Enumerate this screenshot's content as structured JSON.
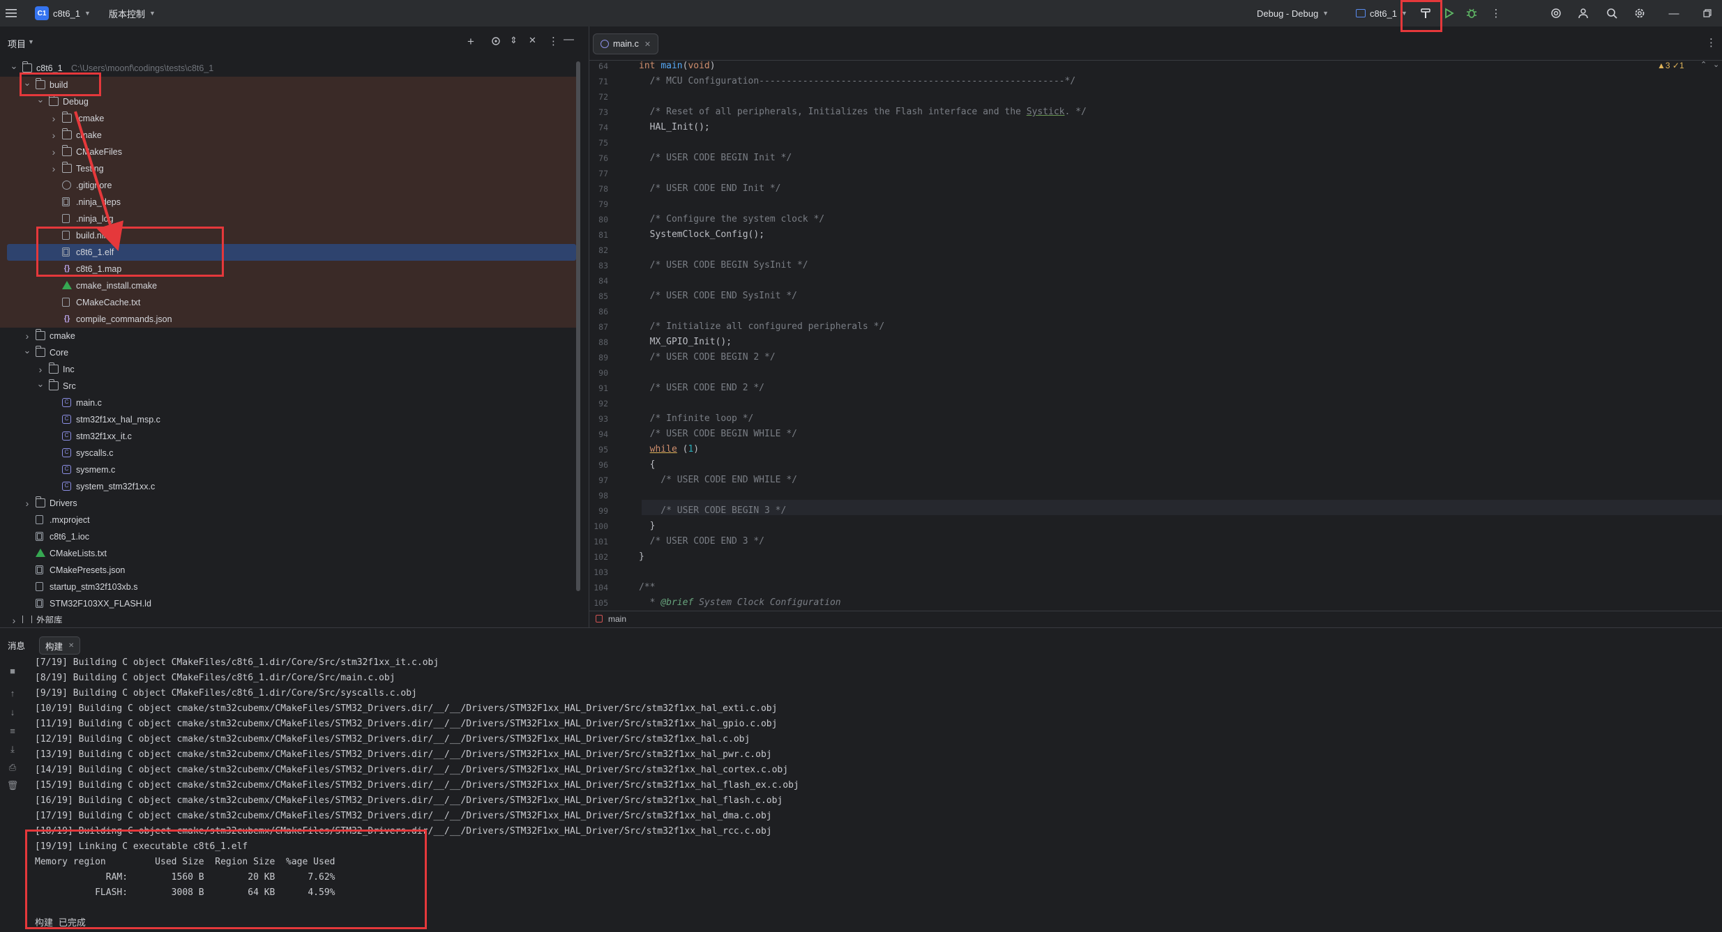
{
  "titlebar": {
    "project_badge": "C1",
    "project_name": "c8t6_1",
    "vcs_label": "版本控制",
    "run_config": "Debug - Debug",
    "target": "c8t6_1"
  },
  "project_panel": {
    "title": "项目",
    "tree": [
      {
        "label": "c8t6_1",
        "extra": "C:\\Users\\moonf\\codings\\tests\\c8t6_1",
        "depth": 0,
        "type": "folder",
        "arrow": "down"
      },
      {
        "label": "build",
        "depth": 1,
        "type": "folder",
        "arrow": "down",
        "hl": true
      },
      {
        "label": "Debug",
        "depth": 2,
        "type": "folder",
        "arrow": "down",
        "hl": true
      },
      {
        "label": ".cmake",
        "depth": 3,
        "type": "folder",
        "arrow": "right",
        "hl": true
      },
      {
        "label": "cmake",
        "depth": 3,
        "type": "folder",
        "arrow": "right",
        "hl": true
      },
      {
        "label": "CMakeFiles",
        "depth": 3,
        "type": "folder",
        "arrow": "right",
        "hl": true
      },
      {
        "label": "Testing",
        "depth": 3,
        "type": "folder",
        "arrow": "right",
        "hl": true
      },
      {
        "label": ".gitignore",
        "depth": 3,
        "type": "ignore",
        "hl": true
      },
      {
        "label": ".ninja_deps",
        "depth": 3,
        "type": "bin",
        "hl": true
      },
      {
        "label": ".ninja_log",
        "depth": 3,
        "type": "text",
        "hl": true
      },
      {
        "label": "build.ninja",
        "depth": 3,
        "type": "text",
        "hl": true
      },
      {
        "label": "c8t6_1.elf",
        "depth": 3,
        "type": "bin",
        "hl": true,
        "selected": true
      },
      {
        "label": "c8t6_1.map",
        "depth": 3,
        "type": "json",
        "hl": true
      },
      {
        "label": "cmake_install.cmake",
        "depth": 3,
        "type": "cmake",
        "hl": true
      },
      {
        "label": "CMakeCache.txt",
        "depth": 3,
        "type": "text",
        "hl": true
      },
      {
        "label": "compile_commands.json",
        "depth": 3,
        "type": "json",
        "hl": true
      },
      {
        "label": "cmake",
        "depth": 1,
        "type": "folder",
        "arrow": "right"
      },
      {
        "label": "Core",
        "depth": 1,
        "type": "folder",
        "arrow": "down"
      },
      {
        "label": "Inc",
        "depth": 2,
        "type": "folder",
        "arrow": "right"
      },
      {
        "label": "Src",
        "depth": 2,
        "type": "folder",
        "arrow": "down"
      },
      {
        "label": "main.c",
        "depth": 3,
        "type": "c"
      },
      {
        "label": "stm32f1xx_hal_msp.c",
        "depth": 3,
        "type": "c"
      },
      {
        "label": "stm32f1xx_it.c",
        "depth": 3,
        "type": "c"
      },
      {
        "label": "syscalls.c",
        "depth": 3,
        "type": "c"
      },
      {
        "label": "sysmem.c",
        "depth": 3,
        "type": "c"
      },
      {
        "label": "system_stm32f1xx.c",
        "depth": 3,
        "type": "c"
      },
      {
        "label": "Drivers",
        "depth": 1,
        "type": "folder",
        "arrow": "right"
      },
      {
        "label": ".mxproject",
        "depth": 1,
        "type": "text"
      },
      {
        "label": "c8t6_1.ioc",
        "depth": 1,
        "type": "bin"
      },
      {
        "label": "CMakeLists.txt",
        "depth": 1,
        "type": "cmake"
      },
      {
        "label": "CMakePresets.json",
        "depth": 1,
        "type": "bin"
      },
      {
        "label": "startup_stm32f103xb.s",
        "depth": 1,
        "type": "text"
      },
      {
        "label": "STM32F103XX_FLASH.ld",
        "depth": 1,
        "type": "bin"
      },
      {
        "label": "外部库",
        "depth": 0,
        "type": "lib",
        "arrow": "right"
      }
    ]
  },
  "editor": {
    "tab_label": "main.c",
    "inspections": "▲3 ✓1",
    "lines": [
      {
        "n": "64",
        "t": "int main(void)",
        "k": "sig"
      },
      {
        "n": "71",
        "t": "  /* MCU Configuration--------------------------------------------------------*/",
        "k": "cmt"
      },
      {
        "n": "72",
        "t": "",
        "k": "plain"
      },
      {
        "n": "73",
        "t": "  /* Reset of all peripherals, Initializes the Flash interface and the Systick. */",
        "k": "cmt"
      },
      {
        "n": "74",
        "t": "  HAL_Init();",
        "k": "plain"
      },
      {
        "n": "75",
        "t": "",
        "k": "plain"
      },
      {
        "n": "76",
        "t": "  /* USER CODE BEGIN Init */",
        "k": "cmt"
      },
      {
        "n": "77",
        "t": "",
        "k": "plain"
      },
      {
        "n": "78",
        "t": "  /* USER CODE END Init */",
        "k": "cmt"
      },
      {
        "n": "79",
        "t": "",
        "k": "plain"
      },
      {
        "n": "80",
        "t": "  /* Configure the system clock */",
        "k": "cmt"
      },
      {
        "n": "81",
        "t": "  SystemClock_Config();",
        "k": "plain"
      },
      {
        "n": "82",
        "t": "",
        "k": "plain"
      },
      {
        "n": "83",
        "t": "  /* USER CODE BEGIN SysInit */",
        "k": "cmt"
      },
      {
        "n": "84",
        "t": "",
        "k": "plain"
      },
      {
        "n": "85",
        "t": "  /* USER CODE END SysInit */",
        "k": "cmt"
      },
      {
        "n": "86",
        "t": "",
        "k": "plain"
      },
      {
        "n": "87",
        "t": "  /* Initialize all configured peripherals */",
        "k": "cmt"
      },
      {
        "n": "88",
        "t": "  MX_GPIO_Init();",
        "k": "plain"
      },
      {
        "n": "89",
        "t": "  /* USER CODE BEGIN 2 */",
        "k": "cmt"
      },
      {
        "n": "90",
        "t": "",
        "k": "plain"
      },
      {
        "n": "91",
        "t": "  /* USER CODE END 2 */",
        "k": "cmt"
      },
      {
        "n": "92",
        "t": "",
        "k": "plain"
      },
      {
        "n": "93",
        "t": "  /* Infinite loop */",
        "k": "cmt"
      },
      {
        "n": "94",
        "t": "  /* USER CODE BEGIN WHILE */",
        "k": "cmt"
      },
      {
        "n": "95",
        "t": "  while (1)",
        "k": "while"
      },
      {
        "n": "96",
        "t": "  {",
        "k": "plain"
      },
      {
        "n": "97",
        "t": "    /* USER CODE END WHILE */",
        "k": "cmt"
      },
      {
        "n": "98",
        "t": "",
        "k": "plain"
      },
      {
        "n": "99",
        "t": "    /* USER CODE BEGIN 3 */",
        "k": "cmt"
      },
      {
        "n": "100",
        "t": "  }",
        "k": "plain"
      },
      {
        "n": "101",
        "t": "  /* USER CODE END 3 */",
        "k": "cmt"
      },
      {
        "n": "102",
        "t": "}",
        "k": "plain"
      },
      {
        "n": "103",
        "t": "",
        "k": "plain"
      },
      {
        "n": "104",
        "t": "/**",
        "k": "cmt"
      },
      {
        "n": "105",
        "t": "  * @brief System Clock Configuration",
        "k": "cmt"
      }
    ],
    "breadcrumb": "main"
  },
  "bottom_panel": {
    "label_messages": "消息",
    "tab_build": "构建",
    "log": [
      "[7/19] Building C object CMakeFiles/c8t6_1.dir/Core/Src/stm32f1xx_it.c.obj",
      "[8/19] Building C object CMakeFiles/c8t6_1.dir/Core/Src/main.c.obj",
      "[9/19] Building C object CMakeFiles/c8t6_1.dir/Core/Src/syscalls.c.obj",
      "[10/19] Building C object cmake/stm32cubemx/CMakeFiles/STM32_Drivers.dir/__/__/Drivers/STM32F1xx_HAL_Driver/Src/stm32f1xx_hal_exti.c.obj",
      "[11/19] Building C object cmake/stm32cubemx/CMakeFiles/STM32_Drivers.dir/__/__/Drivers/STM32F1xx_HAL_Driver/Src/stm32f1xx_hal_gpio.c.obj",
      "[12/19] Building C object cmake/stm32cubemx/CMakeFiles/STM32_Drivers.dir/__/__/Drivers/STM32F1xx_HAL_Driver/Src/stm32f1xx_hal.c.obj",
      "[13/19] Building C object cmake/stm32cubemx/CMakeFiles/STM32_Drivers.dir/__/__/Drivers/STM32F1xx_HAL_Driver/Src/stm32f1xx_hal_pwr.c.obj",
      "[14/19] Building C object cmake/stm32cubemx/CMakeFiles/STM32_Drivers.dir/__/__/Drivers/STM32F1xx_HAL_Driver/Src/stm32f1xx_hal_cortex.c.obj",
      "[15/19] Building C object cmake/stm32cubemx/CMakeFiles/STM32_Drivers.dir/__/__/Drivers/STM32F1xx_HAL_Driver/Src/stm32f1xx_hal_flash_ex.c.obj",
      "[16/19] Building C object cmake/stm32cubemx/CMakeFiles/STM32_Drivers.dir/__/__/Drivers/STM32F1xx_HAL_Driver/Src/stm32f1xx_hal_flash.c.obj",
      "[17/19] Building C object cmake/stm32cubemx/CMakeFiles/STM32_Drivers.dir/__/__/Drivers/STM32F1xx_HAL_Driver/Src/stm32f1xx_hal_dma.c.obj",
      "[18/19] Building C object cmake/stm32cubemx/CMakeFiles/STM32_Drivers.dir/__/__/Drivers/STM32F1xx_HAL_Driver/Src/stm32f1xx_hal_rcc.c.obj",
      "[19/19] Linking C executable c8t6_1.elf",
      "Memory region         Used Size  Region Size  %age Used",
      "             RAM:        1560 B        20 KB      7.62%",
      "           FLASH:        3008 B        64 KB      4.59%",
      "",
      "构建 已完成"
    ]
  },
  "icons": {
    "menu": "hamburger-menu-icon",
    "hammer": "build-hammer-icon",
    "run": "run-icon",
    "debug": "debug-bug-icon"
  },
  "colors": {
    "accent": "#3574f0",
    "annotation_red": "#e5383b",
    "selection": "#2e436e",
    "build_tint": "#3a2a27",
    "run_green": "#5fb865"
  }
}
